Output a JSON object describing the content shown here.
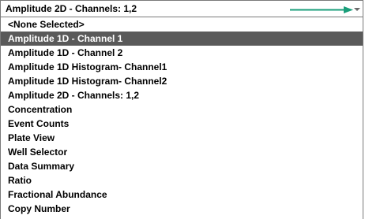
{
  "combo": {
    "value": "Amplitude 2D - Channels: 1,2",
    "accent_color": "#1a9e7a",
    "arrow_icon": "right-arrow-icon",
    "dropdown_icon": "chevron-down-icon"
  },
  "list": {
    "selected_index": 1,
    "items": [
      "<None Selected>",
      "Amplitude 1D  - Channel 1",
      "Amplitude 1D  - Channel 2",
      "Amplitude 1D Histogram- Channel1",
      "Amplitude 1D Histogram- Channel2",
      "Amplitude 2D - Channels: 1,2",
      "Concentration",
      "Event Counts",
      "Plate View",
      "Well Selector",
      "Data Summary",
      "Ratio",
      "Fractional Abundance",
      "Copy Number"
    ]
  }
}
